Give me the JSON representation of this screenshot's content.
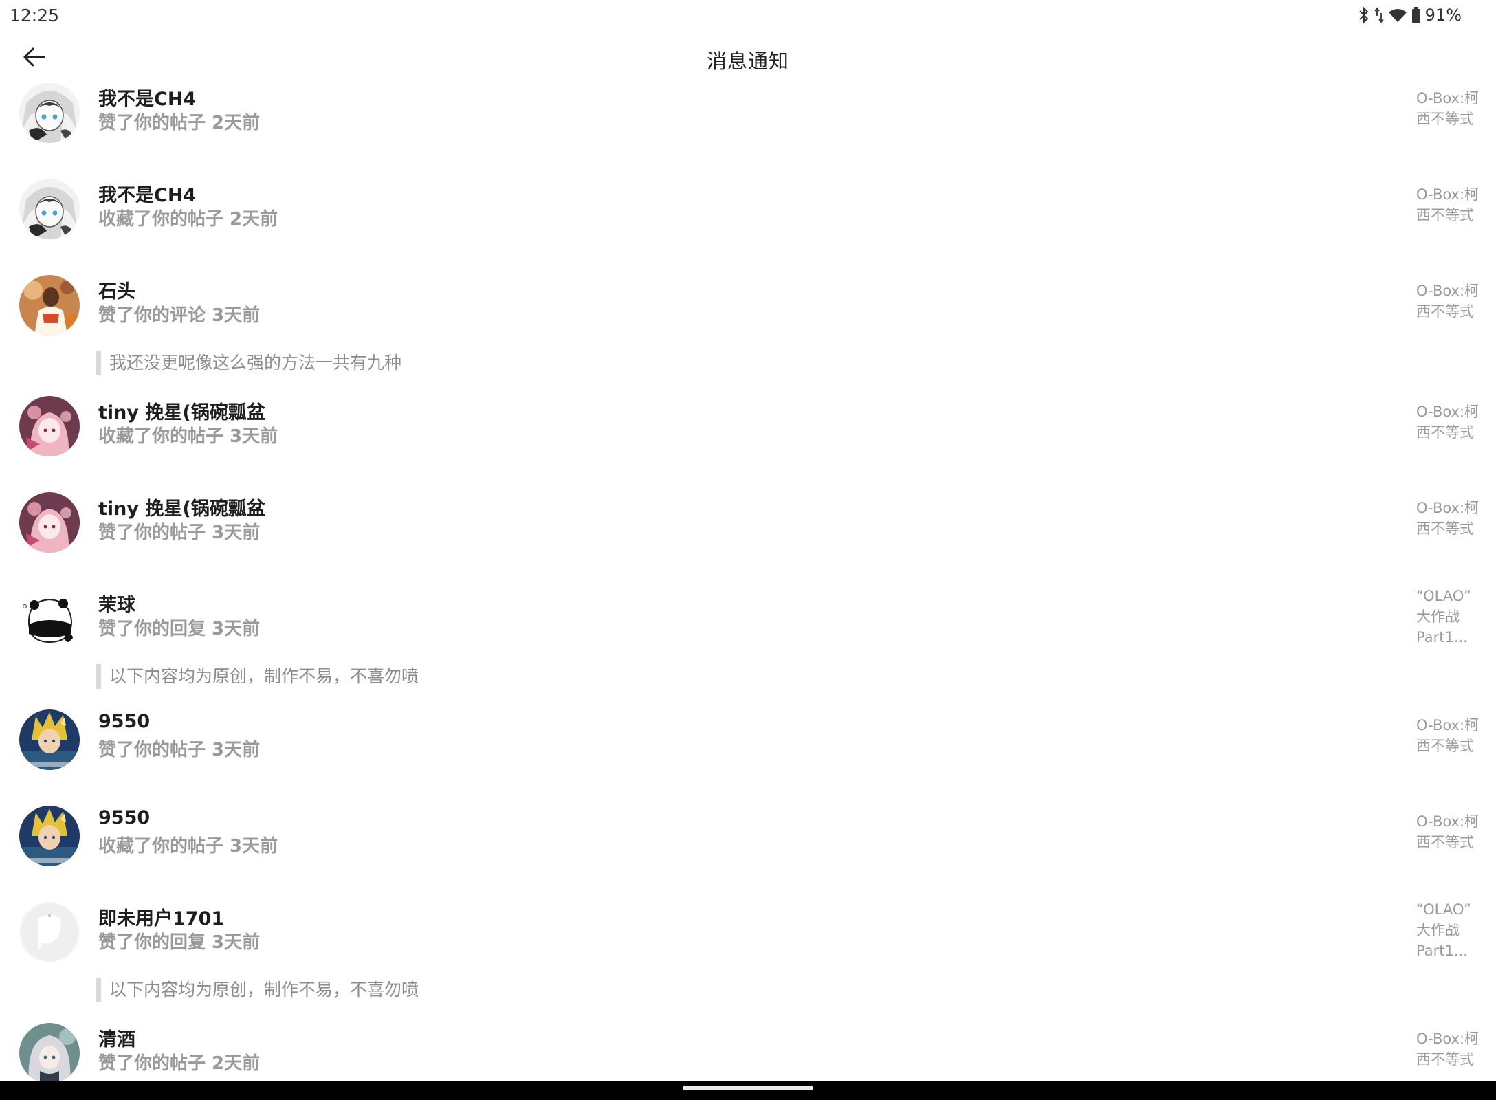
{
  "status_bar": {
    "time": "12:25",
    "battery_percent": "91%",
    "icons": [
      "bluetooth-icon",
      "data-arrows-icon",
      "wifi-icon",
      "battery-icon"
    ]
  },
  "header": {
    "title": "消息通知",
    "back_icon": "arrow-left-icon"
  },
  "notifications": [
    {
      "user": "我不是CH4",
      "action": "赞了你的帖子 2天前",
      "source_line1": "O-Box:柯",
      "source_line2": "西不等式",
      "avatar": "anime-girl-white-hair"
    },
    {
      "user": "我不是CH4",
      "action": "收藏了你的帖子 2天前",
      "source_line1": "O-Box:柯",
      "source_line2": "西不等式",
      "avatar": "anime-girl-white-hair"
    },
    {
      "user": "石头",
      "action": "赞了你的评论 3天前",
      "quote": "我还没更呢像这么强的方法一共有九种",
      "source_line1": "O-Box:柯",
      "source_line2": "西不等式",
      "avatar": "basketball-player"
    },
    {
      "user": "tiny 挽星(锅碗瓢盆",
      "action": "收藏了你的帖子 3天前",
      "source_line1": "O-Box:柯",
      "source_line2": "西不等式",
      "avatar": "anime-girl-pink"
    },
    {
      "user": "tiny 挽星(锅碗瓢盆",
      "action": "赞了你的帖子 3天前",
      "source_line1": "O-Box:柯",
      "source_line2": "西不等式",
      "avatar": "anime-girl-pink"
    },
    {
      "user": "茉球",
      "action": "赞了你的回复 3天前",
      "quote": "以下内容均为原创，制作不易，不喜勿喷",
      "source_line1": "“OLAO”",
      "source_line2": "大作战",
      "source_line3": "Part1...",
      "avatar": "panda"
    },
    {
      "user": "9550",
      "action": "赞了你的帖子 3天前",
      "source_line1": "O-Box:柯",
      "source_line2": "西不等式",
      "avatar": "anime-blonde-hero"
    },
    {
      "user": "9550",
      "action": "收藏了你的帖子 3天前",
      "source_line1": "O-Box:柯",
      "source_line2": "西不等式",
      "avatar": "anime-blonde-hero"
    },
    {
      "user": "即未用户1701",
      "action": "赞了你的回复 3天前",
      "quote": "以下内容均为原创，制作不易，不喜勿喷",
      "source_line1": "“OLAO”",
      "source_line2": "大作战",
      "source_line3": "Part1...",
      "avatar": "default-blank"
    },
    {
      "user": "清酒",
      "action": "赞了你的帖子 2天前",
      "source_line1": "O-Box:柯",
      "source_line2": "西不等式",
      "avatar": "anime-girl-silver-hair"
    }
  ],
  "colors": {
    "background": "#ffffff",
    "name_text": "#1e1e1e",
    "secondary_text": "#9a9a9a",
    "quote_bar": "#d9d9d9",
    "nav_bar": "#000000"
  }
}
